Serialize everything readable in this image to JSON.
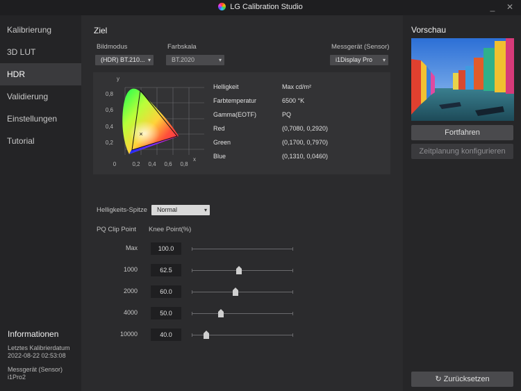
{
  "app": {
    "title": "LG Calibration Studio",
    "minimize": "_",
    "close": "✕"
  },
  "sidebar": {
    "items": [
      {
        "label": "Kalibrierung"
      },
      {
        "label": "3D LUT"
      },
      {
        "label": "HDR"
      },
      {
        "label": "Validierung"
      },
      {
        "label": "Einstellungen"
      },
      {
        "label": "Tutorial"
      }
    ],
    "active": "HDR",
    "info": {
      "title": "Informationen",
      "last_cal_label": "Letztes Kalibrierdatum",
      "last_cal_value": "2022-08-22 02:53:08",
      "sensor_label": "Messgerät (Sensor)",
      "sensor_value": "i1Pro2"
    }
  },
  "target": {
    "title": "Ziel",
    "picture_mode": {
      "label": "Bildmodus",
      "value": "(HDR) BT.210..."
    },
    "color_space": {
      "label": "Farbskala",
      "value": "BT.2020"
    },
    "sensor": {
      "label": "Messgerät (Sensor)",
      "value": "i1Display Pro"
    },
    "properties": [
      {
        "name": "Helligkeit",
        "value": "Max cd/m²"
      },
      {
        "name": "Farbtemperatur",
        "value": "6500 °K"
      },
      {
        "name": "Gamma(EOTF)",
        "value": "PQ"
      },
      {
        "name": "Red",
        "value": "(0,7080, 0,2920)"
      },
      {
        "name": "Green",
        "value": "(0,1700, 0,7970)"
      },
      {
        "name": "Blue",
        "value": "(0,1310, 0,0460)"
      }
    ],
    "diagram": {
      "x_axis_label": "x",
      "y_axis_label": "y",
      "x_ticks": [
        "0",
        "0,2",
        "0,4",
        "0,6",
        "0,8"
      ],
      "y_ticks": [
        "0,8",
        "0,6",
        "0,4",
        "0,2"
      ],
      "white_point_marker": "×"
    }
  },
  "hdr": {
    "peak_label": "Helligkeits-Spitze",
    "peak_value": "Normal",
    "col_pq": "PQ Clip Point",
    "col_knee": "Knee Point(%)",
    "rows": [
      {
        "label": "Max",
        "value": "100.0",
        "knee": 1.0
      },
      {
        "label": "1000",
        "value": "62.5",
        "knee": 0.625
      },
      {
        "label": "2000",
        "value": "60.0",
        "knee": 0.6
      },
      {
        "label": "4000",
        "value": "50.0",
        "knee": 0.5
      },
      {
        "label": "10000",
        "value": "40.0",
        "knee": 0.4
      }
    ]
  },
  "preview": {
    "title": "Vorschau",
    "continue_label": "Fortfahren",
    "schedule_label": "Zeitplanung konfigurieren",
    "reset_label": "Zurücksetzen",
    "reset_icon": "↻"
  }
}
